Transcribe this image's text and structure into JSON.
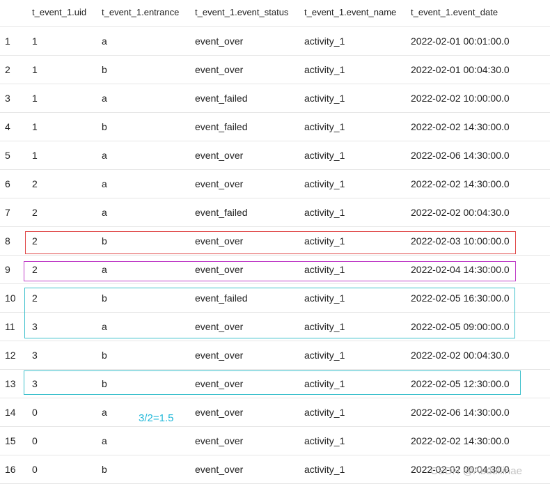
{
  "table": {
    "columns": [
      "t_event_1.uid",
      "t_event_1.entrance",
      "t_event_1.event_status",
      "t_event_1.event_name",
      "t_event_1.event_date"
    ],
    "rows": [
      [
        "1",
        "1",
        "a",
        "event_over",
        "activity_1",
        "2022-02-01 00:01:00.0"
      ],
      [
        "2",
        "1",
        "b",
        "event_over",
        "activity_1",
        "2022-02-01 00:04:30.0"
      ],
      [
        "3",
        "1",
        "a",
        "event_failed",
        "activity_1",
        "2022-02-02 10:00:00.0"
      ],
      [
        "4",
        "1",
        "b",
        "event_failed",
        "activity_1",
        "2022-02-02 14:30:00.0"
      ],
      [
        "5",
        "1",
        "a",
        "event_over",
        "activity_1",
        "2022-02-06 14:30:00.0"
      ],
      [
        "6",
        "2",
        "a",
        "event_over",
        "activity_1",
        "2022-02-02 14:30:00.0"
      ],
      [
        "7",
        "2",
        "a",
        "event_failed",
        "activity_1",
        "2022-02-02 00:04:30.0"
      ],
      [
        "8",
        "2",
        "b",
        "event_over",
        "activity_1",
        "2022-02-03 10:00:00.0"
      ],
      [
        "9",
        "2",
        "a",
        "event_over",
        "activity_1",
        "2022-02-04 14:30:00.0"
      ],
      [
        "10",
        "2",
        "b",
        "event_failed",
        "activity_1",
        "2022-02-05 16:30:00.0"
      ],
      [
        "11",
        "3",
        "a",
        "event_over",
        "activity_1",
        "2022-02-05 09:00:00.0"
      ],
      [
        "12",
        "3",
        "b",
        "event_over",
        "activity_1",
        "2022-02-02 00:04:30.0"
      ],
      [
        "13",
        "3",
        "b",
        "event_over",
        "activity_1",
        "2022-02-05 12:30:00.0"
      ],
      [
        "14",
        "0",
        "a",
        "event_over",
        "activity_1",
        "2022-02-06 14:30:00.0"
      ],
      [
        "15",
        "0",
        "a",
        "event_over",
        "activity_1",
        "2022-02-02 14:30:00.0"
      ],
      [
        "16",
        "0",
        "b",
        "event_over",
        "activity_1",
        "2022-02-02 00:04:30.0"
      ]
    ]
  },
  "annotation": {
    "text": "3/2=1.5",
    "color": "#21b8d9"
  },
  "highlight_colors": {
    "row_8": "#e04848",
    "row_9": "#c040c8",
    "rows_10_11": "#3cc0cc",
    "row_13": "#3cc0cc"
  },
  "watermark": "CSDN @Abdullinae"
}
